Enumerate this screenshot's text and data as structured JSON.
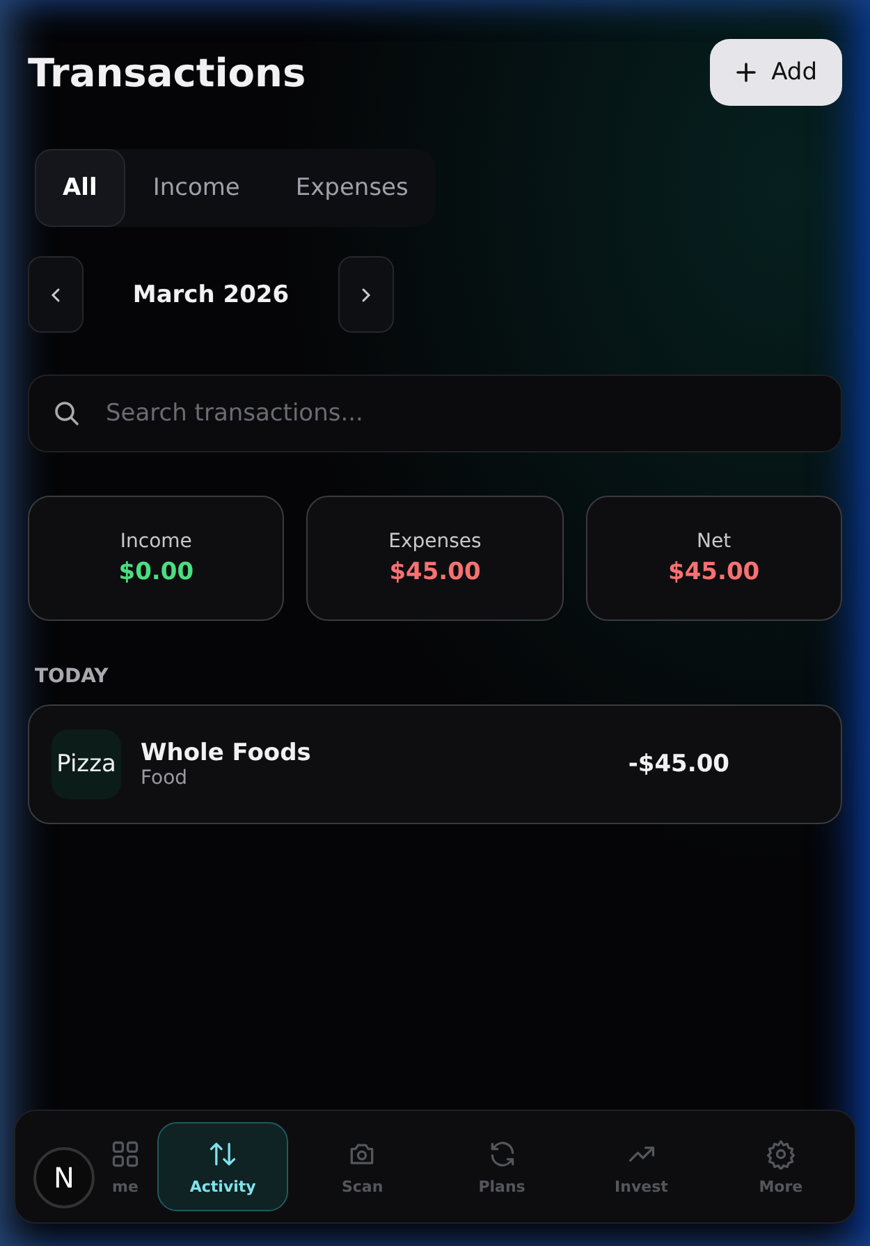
{
  "header": {
    "title": "Transactions",
    "add_button": "Add"
  },
  "tabs": [
    {
      "label": "All",
      "selected": true
    },
    {
      "label": "Income",
      "selected": false
    },
    {
      "label": "Expenses",
      "selected": false
    }
  ],
  "month": {
    "label": "March 2026"
  },
  "search": {
    "placeholder": "Search transactions..."
  },
  "summary": [
    {
      "label": "Income",
      "value": "$0.00",
      "color": "#4ade80"
    },
    {
      "label": "Expenses",
      "value": "$45.00",
      "color": "#f87171"
    },
    {
      "label": "Net",
      "value": "$45.00",
      "color": "#f87171"
    }
  ],
  "groups": [
    {
      "heading": "TODAY",
      "transactions": [
        {
          "icon_text": "Pizza",
          "name": "Whole Foods",
          "category": "Food",
          "amount": "-$45.00"
        }
      ]
    }
  ],
  "nav": [
    {
      "label": "me",
      "selected": false
    },
    {
      "label": "Activity",
      "selected": true
    },
    {
      "label": "Scan",
      "selected": false
    },
    {
      "label": "Plans",
      "selected": false
    },
    {
      "label": "Invest",
      "selected": false
    },
    {
      "label": "More",
      "selected": false
    }
  ],
  "badge": {
    "letter": "N"
  }
}
